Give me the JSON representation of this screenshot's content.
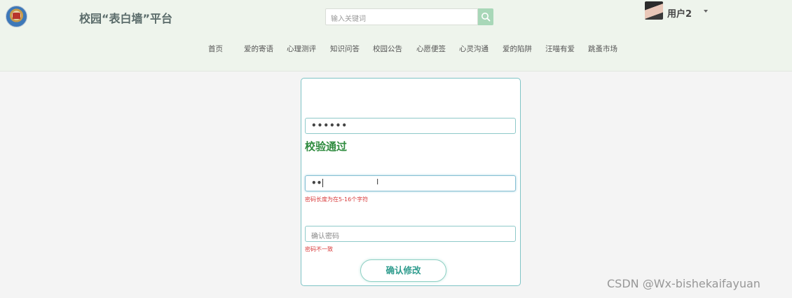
{
  "header": {
    "site_title": "校园“表白墙”平台",
    "search_placeholder": "输入关键词",
    "user_name": "用户2"
  },
  "nav": {
    "items": [
      {
        "label": "首页"
      },
      {
        "label": "爱的寄语"
      },
      {
        "label": "心理测评"
      },
      {
        "label": "知识问答"
      },
      {
        "label": "校园公告"
      },
      {
        "label": "心愿便签"
      },
      {
        "label": "心灵沟通"
      },
      {
        "label": "爱的陷阱"
      },
      {
        "label": "汪喵有爱"
      },
      {
        "label": "跳蚤市场"
      }
    ]
  },
  "form": {
    "password1_value": "••••••",
    "password1_validation": "校验通过",
    "password2_value": "••",
    "password2_error": "密码长度为在5-16个字符",
    "confirm_placeholder": "确认密码",
    "confirm_error": "密码不一致",
    "submit_label": "确认修改"
  },
  "watermark": "CSDN @Wx-bishekaifayuan",
  "colors": {
    "header_bg": "#eef4ec",
    "accent": "#2f9c8e",
    "success": "#2e8b3e",
    "error": "#d83a3a"
  },
  "icons": {
    "logo": "campus-emblem-icon",
    "search": "search-icon",
    "caret": "chevron-down-icon"
  }
}
